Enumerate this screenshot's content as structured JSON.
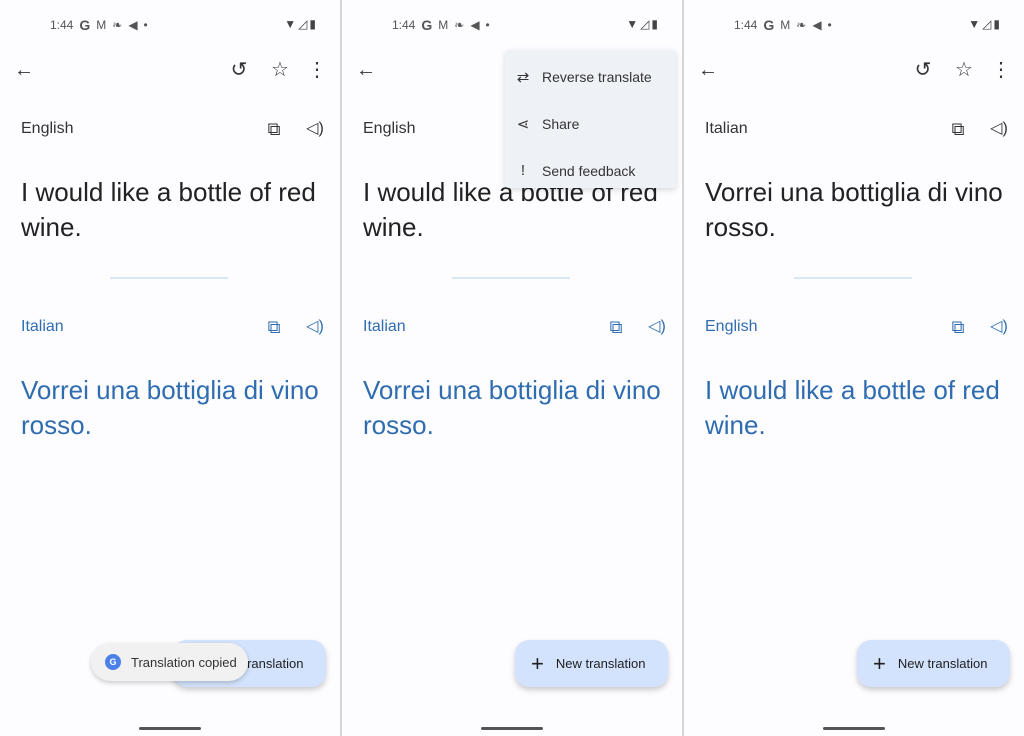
{
  "panels": [
    {
      "time": "1:44",
      "source_lang": "English",
      "source_text": "I would like a bottle of red wine.",
      "target_lang": "Italian",
      "target_text": "Vorrei una bottiglia di vino rosso.",
      "fab_label": "New translation",
      "toast": "Translation copied"
    },
    {
      "time": "1:44",
      "source_lang": "English",
      "source_text": "I would like a bottle of red wine.",
      "target_lang": "Italian",
      "target_text": "Vorrei una bottiglia di vino rosso.",
      "fab_label": "New translation",
      "menu": [
        {
          "label": "Reverse translate",
          "icon": "swap-icon"
        },
        {
          "label": "Share",
          "icon": "share-icon"
        },
        {
          "label": "Send feedback",
          "icon": "feedback-icon"
        }
      ]
    },
    {
      "time": "1:44",
      "source_lang": "Italian",
      "source_text": "Vorrei una bottiglia di vino rosso.",
      "target_lang": "English",
      "target_text": "I would like a bottle of red wine.",
      "fab_label": "New translation"
    }
  ],
  "colors": {
    "accent": "#2f6db0",
    "fab": "#d3e3fd"
  }
}
